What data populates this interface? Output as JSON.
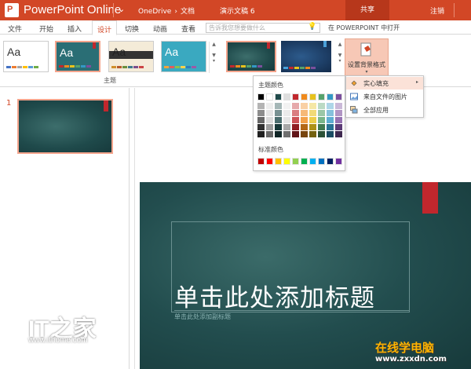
{
  "titlebar": {
    "app_logo": "P",
    "app_name": "PowerPoint Online",
    "breadcrumb": [
      "OneDrive",
      "›",
      "文档"
    ],
    "document_name": "演示文稿 6",
    "share_label": "共享",
    "signout_label": "注销"
  },
  "tabs": [
    {
      "label": "文件"
    },
    {
      "label": "开始"
    },
    {
      "label": "插入"
    },
    {
      "label": "设计"
    },
    {
      "label": "切换"
    },
    {
      "label": "动画"
    },
    {
      "label": "查看"
    }
  ],
  "active_tab": "设计",
  "tell_me": {
    "placeholder": "告诉我您想要做什么",
    "icon": "lightbulb-icon"
  },
  "open_in_desktop": "在 POWERPOINT 中打开",
  "ribbon": {
    "themes_group_label": "主题",
    "theme_thumb_text": "Aa",
    "format_background_label": "设置背景格式",
    "format_background_icon": "paint-bucket-icon"
  },
  "color_picker": {
    "theme_colors_label": "主题颜色",
    "standard_colors_label": "标准颜色",
    "theme_colors": [
      "#000000",
      "#ffffff",
      "#1f4a4b",
      "#dedede",
      "#c1272d",
      "#f08a1c",
      "#e7c21d",
      "#56a26c",
      "#3498c5",
      "#7b4f9d"
    ],
    "standard_colors": [
      "#c00000",
      "#ff0000",
      "#ffc000",
      "#ffff00",
      "#92d050",
      "#00b050",
      "#00b0f0",
      "#0070c0",
      "#002060",
      "#7030a0"
    ]
  },
  "fill_menu": {
    "items": [
      {
        "label": "实心填充",
        "icon": "paint-bucket-icon",
        "has_submenu": true
      },
      {
        "label": "来自文件的图片",
        "icon": "picture-icon",
        "has_submenu": false
      },
      {
        "label": "全部应用",
        "icon": "apply-all-icon",
        "has_submenu": false
      }
    ]
  },
  "slides": [
    {
      "number": "1"
    }
  ],
  "slide": {
    "title_placeholder": "单击此处添加标题",
    "subtitle_placeholder": "单击此处添加副标题"
  },
  "watermarks": {
    "ithome_logo": "IT之家",
    "ithome_url": "www.ithome.com",
    "zxxdn_title": "在线学电脑",
    "zxxdn_url": "www.zxxdn.com"
  }
}
